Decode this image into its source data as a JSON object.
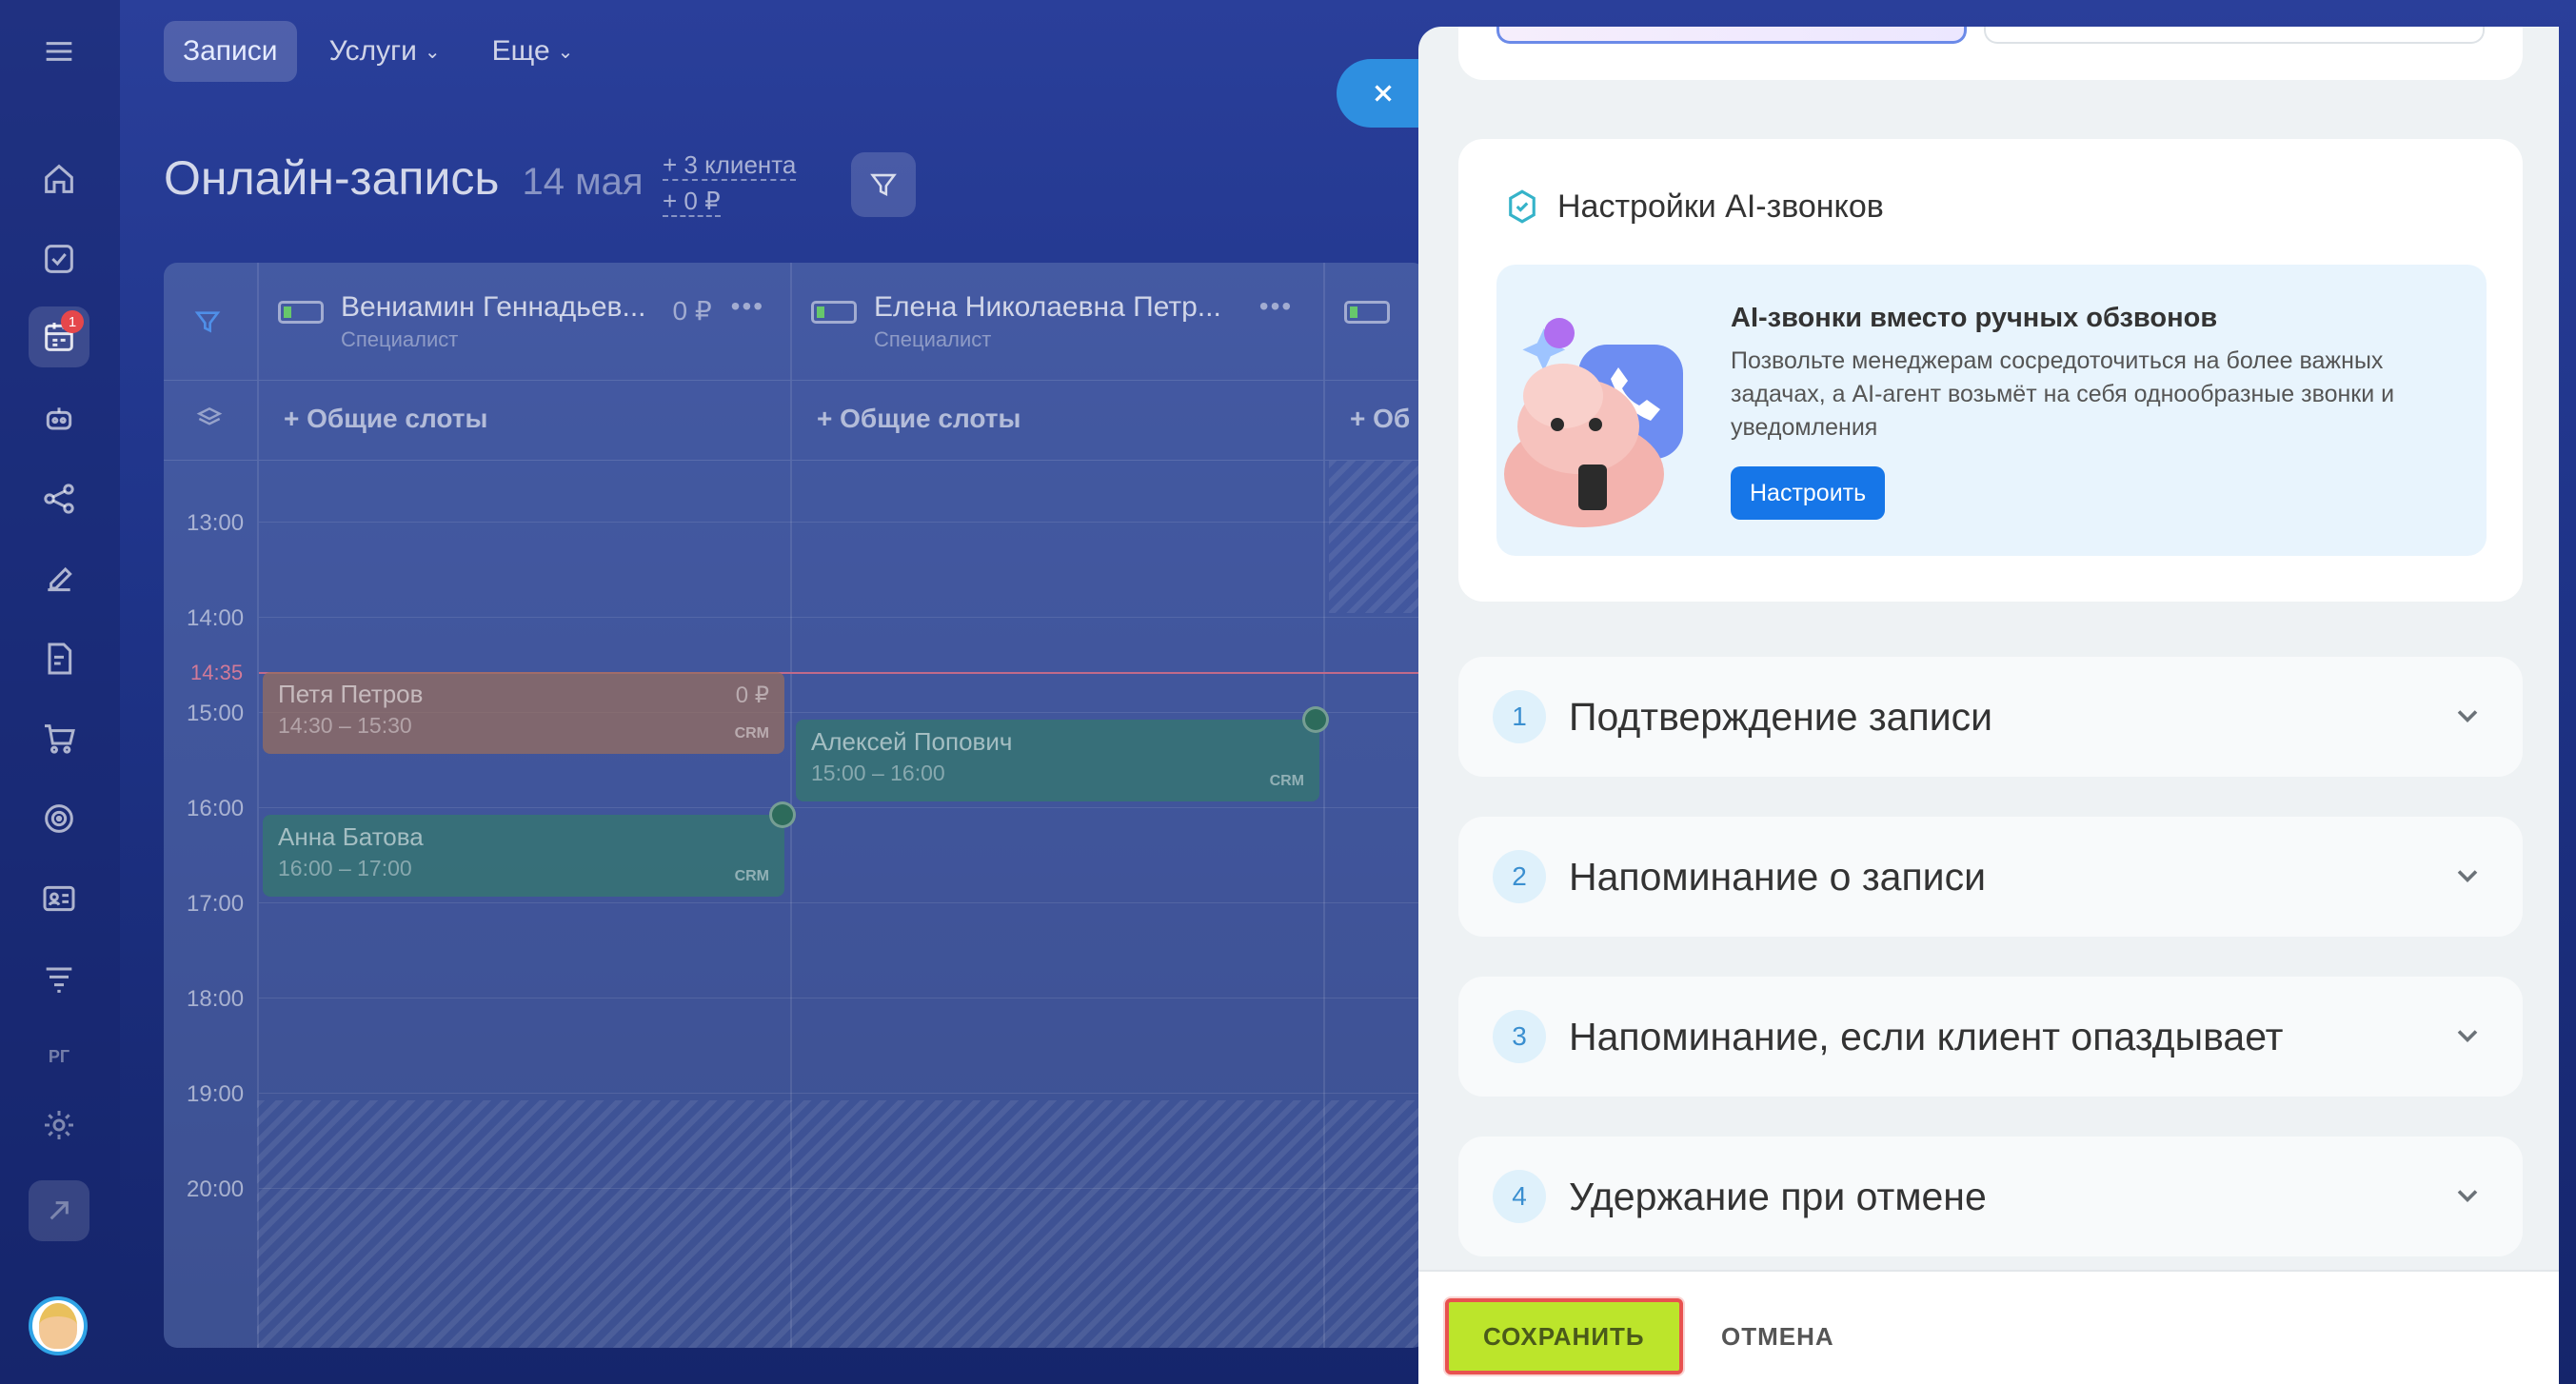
{
  "nav": {
    "tabs": [
      {
        "label": "Записи"
      },
      {
        "label": "Услуги"
      },
      {
        "label": "Еще"
      }
    ]
  },
  "sidebar": {
    "badge_count": "1",
    "rg_label": "РГ",
    "icons": [
      "menu-icon",
      "home-icon",
      "tasks-icon",
      "booking-icon",
      "robot-icon",
      "flow-icon",
      "sign-icon",
      "document-icon",
      "cart-icon",
      "target-icon",
      "contact-card-icon",
      "funnel-icon",
      "settings-icon"
    ]
  },
  "page": {
    "title": "Онлайн-запись",
    "date": "14 мая",
    "clients": "+ 3 клиента",
    "revenue": "+ 0 ₽"
  },
  "calendar": {
    "specialists": [
      {
        "name": "Вениамин Геннадьев...",
        "role": "Специалист",
        "amount": "0 ₽"
      },
      {
        "name": "Елена Николаевна Петр...",
        "role": "Специалист"
      }
    ],
    "shared_slots_label": "+ Общие слоты",
    "shared_slots_label_cut": "+ Об",
    "times": [
      "13:00",
      "14:00",
      "15:00",
      "16:00",
      "17:00",
      "18:00",
      "19:00",
      "20:00"
    ],
    "now_time": "14:35",
    "appointments": [
      {
        "name": "Петя Петров",
        "time": "14:30 – 15:30",
        "amount": "0 ₽",
        "crm": "CRM"
      },
      {
        "name": "Анна Батова",
        "time": "16:00 – 17:00",
        "crm": "CRM"
      },
      {
        "name": "Алексей Попович",
        "time": "15:00 – 16:00",
        "crm": "CRM"
      }
    ]
  },
  "panel": {
    "ai_section_title": "Настройки AI-звонков",
    "promo": {
      "title": "AI-звонки вместо ручных обзвонов",
      "description": "Позвольте менеджерам сосредоточиться на более важных задачах, а AI-агент возьмёт на себя однообразные звонки и уведомления",
      "button": "Настроить"
    },
    "sections": [
      {
        "num": "1",
        "label": "Подтверждение записи"
      },
      {
        "num": "2",
        "label": "Напоминание о записи"
      },
      {
        "num": "3",
        "label": "Напоминание, если клиент опаздывает"
      },
      {
        "num": "4",
        "label": "Удержание при отмене"
      }
    ],
    "footer": {
      "save": "СОХРАНИТЬ",
      "cancel": "ОТМЕНА"
    }
  },
  "colors": {
    "accent": "#1676e8",
    "save_bg": "#bce52b",
    "highlight_border": "#e8524f"
  }
}
